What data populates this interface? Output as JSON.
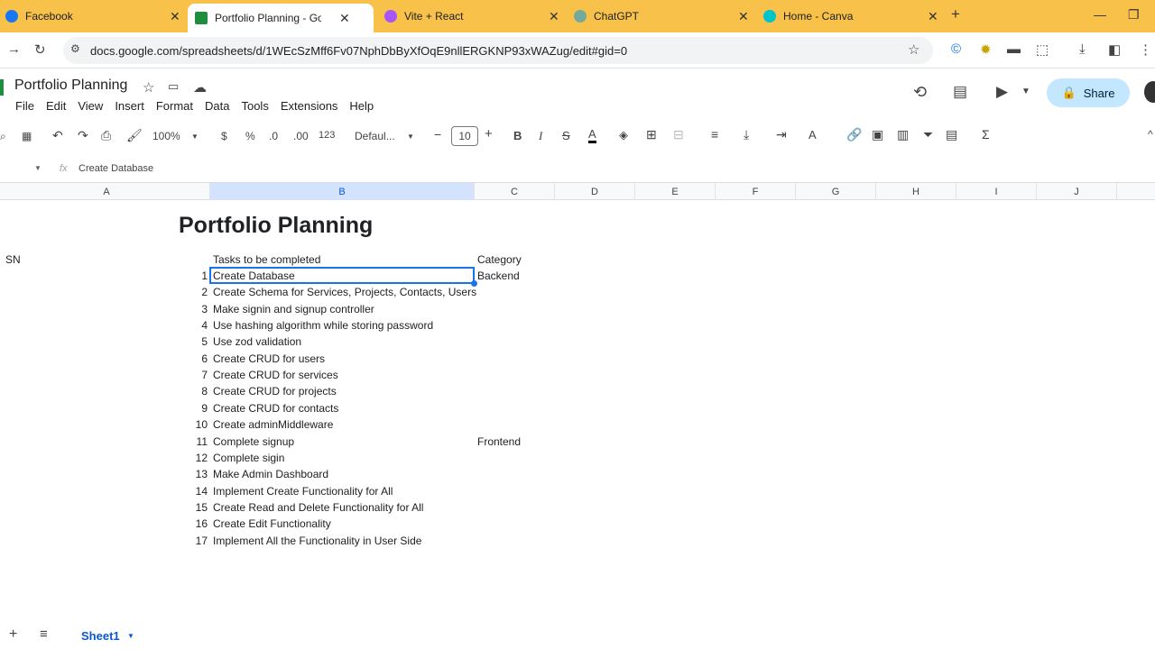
{
  "browser": {
    "tabs": [
      {
        "title": "Facebook",
        "color": "#1877f2"
      },
      {
        "title": "Portfolio Planning - Google She",
        "color": "#1e8e3e"
      },
      {
        "title": "Vite + React",
        "color": "#a855f7"
      },
      {
        "title": "ChatGPT",
        "color": "#74aa9c"
      },
      {
        "title": "Home - Canva",
        "color": "#00c4cc"
      }
    ],
    "new_tab": "+",
    "url": "docs.google.com/spreadsheets/d/1WEcSzMff6Fv07NphDbByXfOqE9nllERGKNP93xWAZug/edit#gid=0"
  },
  "doc": {
    "title": "Portfolio Planning",
    "menu": [
      "File",
      "Edit",
      "View",
      "Insert",
      "Format",
      "Data",
      "Tools",
      "Extensions",
      "Help"
    ],
    "share_label": "Share"
  },
  "toolbar": {
    "zoom": "100%",
    "currency": "$",
    "percent": "%",
    "dec_decrease": ".0",
    "dec_increase": ".00",
    "num_format": "123",
    "font": "Defaul...",
    "font_size": "10"
  },
  "formula": {
    "fx": "fx",
    "content": "Create Database"
  },
  "columns": [
    "A",
    "B",
    "C",
    "D",
    "E",
    "F",
    "G",
    "H",
    "I",
    "J"
  ],
  "sheet": {
    "title": "Portfolio Planning",
    "header_sn": "SN",
    "header_tasks": "Tasks to be completed",
    "header_category": "Category",
    "rows": [
      {
        "n": "1",
        "task": "Create Database",
        "cat": "Backend"
      },
      {
        "n": "2",
        "task": "Create Schema for Services, Projects, Contacts, Users",
        "cat": ""
      },
      {
        "n": "3",
        "task": "Make signin and signup controller",
        "cat": ""
      },
      {
        "n": "4",
        "task": "Use hashing algorithm while storing password",
        "cat": ""
      },
      {
        "n": "5",
        "task": "Use zod validation",
        "cat": ""
      },
      {
        "n": "6",
        "task": "Create CRUD for users",
        "cat": ""
      },
      {
        "n": "7",
        "task": "Create CRUD for services",
        "cat": ""
      },
      {
        "n": "8",
        "task": "Create CRUD for projects",
        "cat": ""
      },
      {
        "n": "9",
        "task": "Create CRUD for contacts",
        "cat": ""
      },
      {
        "n": "10",
        "task": "Create adminMiddleware",
        "cat": ""
      },
      {
        "n": "11",
        "task": "Complete signup",
        "cat": "Frontend"
      },
      {
        "n": "12",
        "task": "Complete sigin",
        "cat": ""
      },
      {
        "n": "13",
        "task": "Make Admin Dashboard",
        "cat": ""
      },
      {
        "n": "14",
        "task": " Implement Create Functionality for All",
        "cat": ""
      },
      {
        "n": "15",
        "task": "Create Read and Delete Functionality for All",
        "cat": ""
      },
      {
        "n": "16",
        "task": "Create Edit Functionality",
        "cat": ""
      },
      {
        "n": "17",
        "task": "Implement All the Functionality in User Side",
        "cat": ""
      }
    ]
  },
  "bottom": {
    "add": "+",
    "sheet_tab": "Sheet1"
  }
}
